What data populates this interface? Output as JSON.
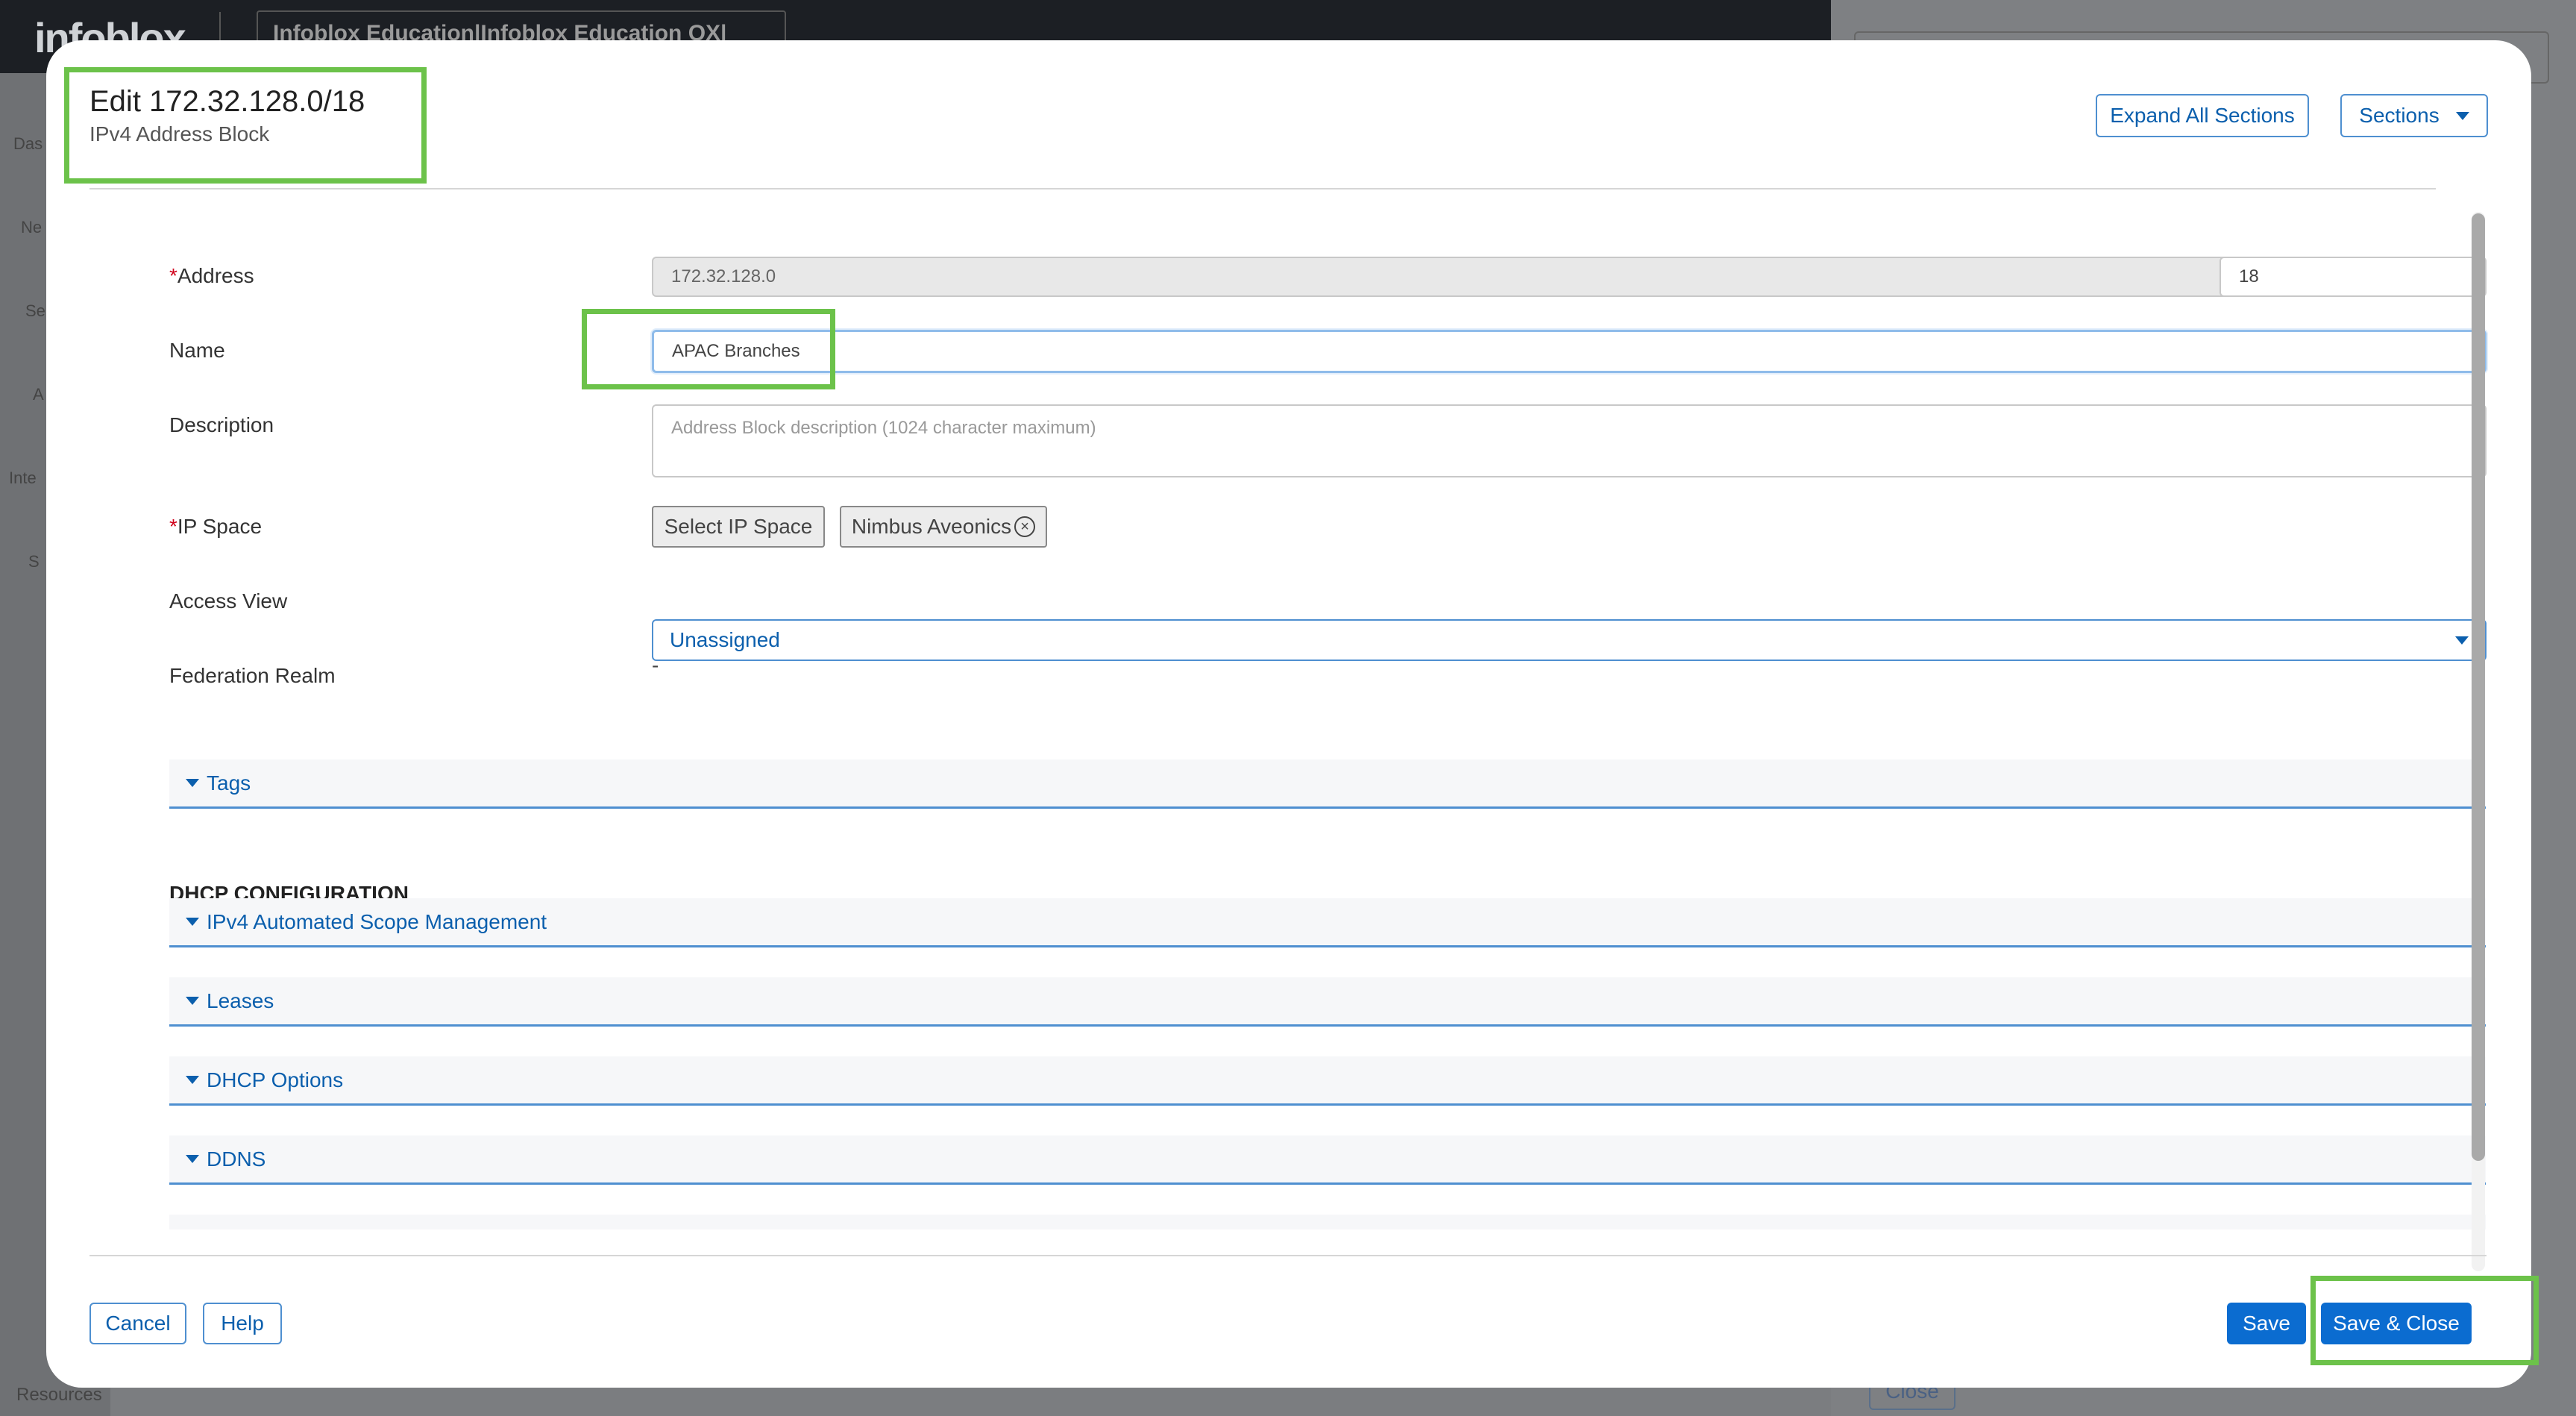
{
  "background": {
    "logo": "infoblox",
    "org_selector": "Infoblox Education|Infoblox Education QX|",
    "sidebar_labels": [
      "Das",
      "Ne",
      "Se",
      "A",
      "Inte",
      "S"
    ],
    "resources": "Resources",
    "close_label": "Close"
  },
  "modal": {
    "title": "Edit 172.32.128.0/18",
    "subtitle": "IPv4 Address Block",
    "expand_all_label": "Expand All Sections",
    "sections_label": "Sections",
    "form": {
      "address": {
        "label": "Address",
        "required_mark": "*",
        "value": "172.32.128.0",
        "slash": "/",
        "cidr": "18"
      },
      "name": {
        "label": "Name",
        "value": "APAC Branches"
      },
      "description": {
        "label": "Description",
        "placeholder": "Address Block description (1024 character maximum)"
      },
      "ip_space": {
        "label": "IP Space",
        "required_mark": "*",
        "select_label": "Select IP Space",
        "selected": "Nimbus Aveonics"
      },
      "access_view": {
        "label": "Access View",
        "value": "Unassigned"
      },
      "federation_realm": {
        "label": "Federation Realm",
        "value": "-"
      }
    },
    "sections": {
      "tags": "Tags",
      "dhcp_heading": "DHCP CONFIGURATION",
      "items": [
        "IPv4 Automated Scope Management",
        "Leases",
        "DHCP Options",
        "DDNS"
      ]
    },
    "footer": {
      "cancel": "Cancel",
      "help": "Help",
      "save": "Save",
      "save_close": "Save & Close"
    }
  },
  "colors": {
    "accent": "#0b6cd0",
    "link": "#0b5fad",
    "highlight": "#6cc24a",
    "required": "#d0021b"
  }
}
